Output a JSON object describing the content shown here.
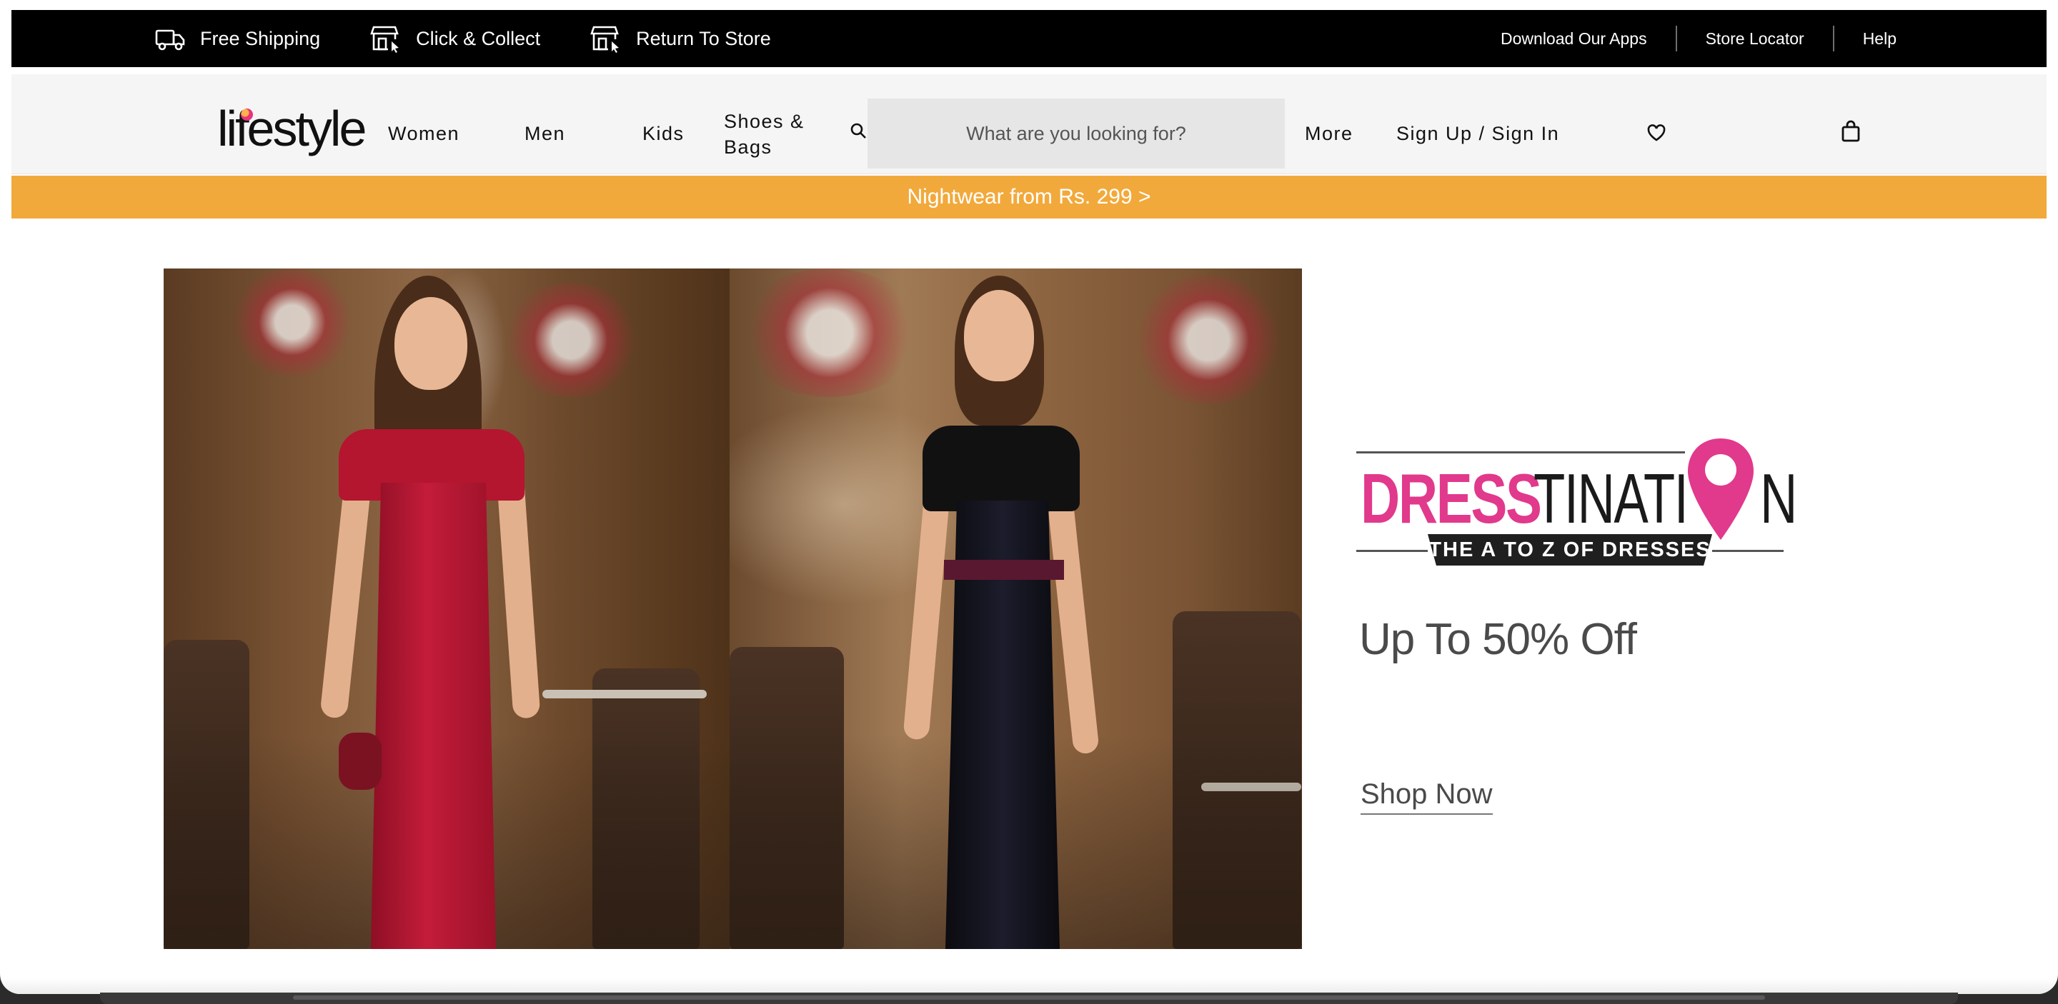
{
  "topbar": {
    "utilities": [
      {
        "label": "Free Shipping",
        "icon": "truck-icon"
      },
      {
        "label": "Click & Collect",
        "icon": "store-click-icon"
      },
      {
        "label": "Return To Store",
        "icon": "store-return-icon"
      }
    ],
    "links": [
      "Download Our Apps",
      "Store Locator",
      "Help"
    ]
  },
  "header": {
    "logo": "lifestyle",
    "nav": {
      "women": "Women",
      "men": "Men",
      "kids": "Kids",
      "shoes_bags": "Shoes & Bags",
      "more": "More",
      "signin": "Sign Up / Sign In"
    },
    "search": {
      "placeholder": "What are you looking for?",
      "value": ""
    },
    "icons": [
      "search-icon",
      "heart-icon",
      "bag-icon"
    ]
  },
  "promo": {
    "text": "Nightwear from Rs. 299 >",
    "color": "#f2a93b"
  },
  "hero": {
    "brand_part1": "DRESS",
    "brand_part2": "TINATI",
    "brand_part3": "N",
    "tagline": "THE A TO Z OF DRESSES",
    "offer": "Up To 50% Off",
    "cta": "Shop Now",
    "accent": "#e1398c"
  }
}
